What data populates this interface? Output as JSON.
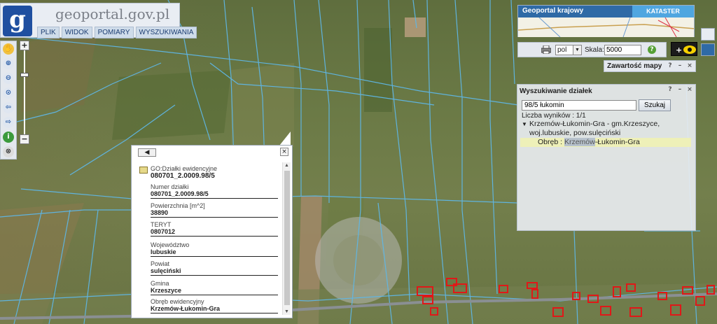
{
  "app": {
    "logo_letter": "g",
    "logo_text": "geoportal.gov.pl",
    "menu": [
      "PLIK",
      "WIDOK",
      "POMIARY",
      "WYSZUKIWANIA"
    ]
  },
  "left_tools": [
    {
      "name": "pan-hand-icon",
      "glyph": "✋"
    },
    {
      "name": "zoom-in-icon",
      "glyph": "⊕"
    },
    {
      "name": "zoom-out-icon",
      "glyph": "⊖"
    },
    {
      "name": "zoom-extent-icon",
      "glyph": "⊙"
    },
    {
      "name": "back-arrow-icon",
      "glyph": "⇦"
    },
    {
      "name": "forward-arrow-icon",
      "glyph": "⇨"
    },
    {
      "name": "info-icon",
      "glyph": "i"
    },
    {
      "name": "crosshair-icon",
      "glyph": "⊗"
    }
  ],
  "zoom": {
    "plus": "+",
    "minus": "−"
  },
  "overview": {
    "title": "Geoportal krajowy",
    "kataster": "KATASTER"
  },
  "scale_toolbar": {
    "language": "pol",
    "scale_label": "Skala:",
    "scale_value": "5000",
    "help": "?"
  },
  "layers_panel": {
    "title": "Zawartość mapy"
  },
  "window_buttons": [
    "?",
    "–",
    "×"
  ],
  "search_panel": {
    "title": "Wyszukiwanie działek",
    "query": "98/5 łukomin",
    "button": "Szukaj",
    "result_count": "Liczba wyników : 1/1",
    "result_line1": "Krzemów-Łukomin-Gra -  gm.Krzeszyce,",
    "result_line2": "woj.lubuskie, pow.sulęciński",
    "obreb_prefix": "Obręb : ",
    "obreb_highlight": "Krzemów",
    "obreb_rest": "-Łukomin-Gra"
  },
  "popup": {
    "back": "◀",
    "close": "×",
    "layer": "GO:Działki ewidencyjne",
    "id": "080701_2.0009.98/5",
    "fields": [
      {
        "label": "Numer działki",
        "value": "080701_2.0009.98/5"
      },
      {
        "label": "Powierzchnia [m^2]",
        "value": "38890"
      },
      {
        "label": "TERYT",
        "value": "0807012"
      },
      {
        "label": "Województwo",
        "value": "lubuskie"
      },
      {
        "label": "Powiat",
        "value": "sulęciński"
      },
      {
        "label": "Gmina",
        "value": "Krzeszyce"
      },
      {
        "label": "Obręb ewidencyjny",
        "value": "Krzemów-Łukomin-Gra"
      }
    ]
  },
  "colors": {
    "parcel_lines": "#5fb7e6",
    "buildings": "#e01818",
    "logo_blue": "#1f4fa0",
    "panel_bg": "#e4e8ee"
  }
}
